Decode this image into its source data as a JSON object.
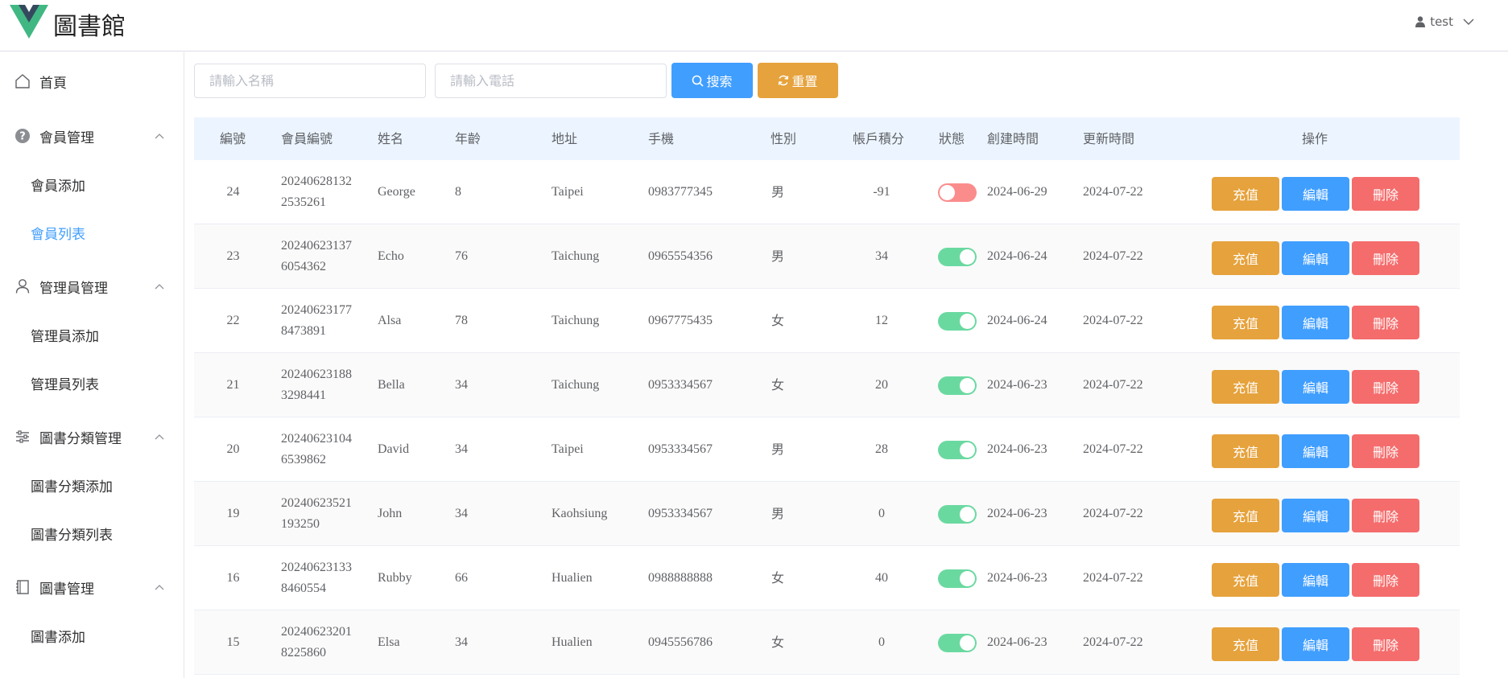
{
  "header": {
    "app_title": "圖書館",
    "user_name": "test"
  },
  "sidebar": {
    "home": "首頁",
    "groups": [
      {
        "label": "會員管理",
        "icon": "question-circle-icon",
        "items": [
          "會員添加",
          "會員列表"
        ]
      },
      {
        "label": "管理員管理",
        "icon": "user-icon",
        "items": [
          "管理員添加",
          "管理員列表"
        ]
      },
      {
        "label": "圖書分類管理",
        "icon": "sliders-icon",
        "items": [
          "圖書分類添加",
          "圖書分類列表"
        ]
      },
      {
        "label": "圖書管理",
        "icon": "notebook-icon",
        "items": [
          "圖書添加"
        ]
      }
    ],
    "active_item": "會員列表"
  },
  "search": {
    "name_placeholder": "請輸入名稱",
    "phone_placeholder": "請輸入電話",
    "search_label": "搜索",
    "reset_label": "重置"
  },
  "table": {
    "columns": [
      "編號",
      "會員編號",
      "姓名",
      "年齡",
      "地址",
      "手機",
      "性別",
      "帳戶積分",
      "狀態",
      "創建時間",
      "更新時間",
      "操作"
    ],
    "action_labels": {
      "recharge": "充值",
      "edit": "編輯",
      "delete": "刪除"
    },
    "rows": [
      {
        "id": "24",
        "member_no_1": "20240628132",
        "member_no_2": "2535261",
        "name": "George",
        "age": "8",
        "address": "Taipei",
        "phone": "0983777345",
        "gender": "男",
        "points": "-91",
        "status": false,
        "created": "2024-06-29",
        "updated": "2024-07-22"
      },
      {
        "id": "23",
        "member_no_1": "20240623137",
        "member_no_2": "6054362",
        "name": "Echo",
        "age": "76",
        "address": "Taichung",
        "phone": "0965554356",
        "gender": "男",
        "points": "34",
        "status": true,
        "created": "2024-06-24",
        "updated": "2024-07-22"
      },
      {
        "id": "22",
        "member_no_1": "20240623177",
        "member_no_2": "8473891",
        "name": "Alsa",
        "age": "78",
        "address": "Taichung",
        "phone": "0967775435",
        "gender": "女",
        "points": "12",
        "status": true,
        "created": "2024-06-24",
        "updated": "2024-07-22"
      },
      {
        "id": "21",
        "member_no_1": "20240623188",
        "member_no_2": "3298441",
        "name": "Bella",
        "age": "34",
        "address": "Taichung",
        "phone": "0953334567",
        "gender": "女",
        "points": "20",
        "status": true,
        "created": "2024-06-23",
        "updated": "2024-07-22"
      },
      {
        "id": "20",
        "member_no_1": "20240623104",
        "member_no_2": "6539862",
        "name": "David",
        "age": "34",
        "address": "Taipei",
        "phone": "0953334567",
        "gender": "男",
        "points": "28",
        "status": true,
        "created": "2024-06-23",
        "updated": "2024-07-22"
      },
      {
        "id": "19",
        "member_no_1": "20240623521",
        "member_no_2": "193250",
        "name": "John",
        "age": "34",
        "address": "Kaohsiung",
        "phone": "0953334567",
        "gender": "男",
        "points": "0",
        "status": true,
        "created": "2024-06-23",
        "updated": "2024-07-22"
      },
      {
        "id": "16",
        "member_no_1": "20240623133",
        "member_no_2": "8460554",
        "name": "Rubby",
        "age": "66",
        "address": "Hualien",
        "phone": "0988888888",
        "gender": "女",
        "points": "40",
        "status": true,
        "created": "2024-06-23",
        "updated": "2024-07-22"
      },
      {
        "id": "15",
        "member_no_1": "20240623201",
        "member_no_2": "8225860",
        "name": "Elsa",
        "age": "34",
        "address": "Hualien",
        "phone": "0945556786",
        "gender": "女",
        "points": "0",
        "status": true,
        "created": "2024-06-23",
        "updated": "2024-07-22"
      }
    ]
  },
  "colors": {
    "primary": "#409eff",
    "warning": "#e6a23c",
    "danger": "#f56c6c",
    "switch_on": "#6ad9a0",
    "switch_off": "#fb8c8c",
    "logo_outer": "#41b883",
    "logo_inner": "#35495e"
  }
}
